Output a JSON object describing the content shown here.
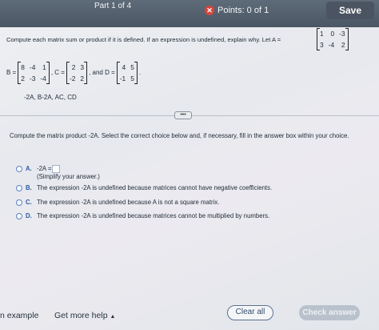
{
  "header": {
    "part_label": "Part 1 of 4",
    "points_label": "Points: 0 of 1",
    "save_label": "Save"
  },
  "problem": {
    "prompt": "Compute each matrix sum or product if it is defined. If an expression is undefined, explain why. Let A =",
    "matrix_A": [
      [
        "1",
        "0",
        "-3"
      ],
      [
        "3",
        "-4",
        "2"
      ]
    ],
    "b_label": "B =",
    "matrix_B": [
      [
        "8",
        "-4",
        "1"
      ],
      [
        "2",
        "-3",
        "-4"
      ]
    ],
    "c_label": ", C =",
    "matrix_C": [
      [
        "2",
        "3"
      ],
      [
        "-2",
        "2"
      ]
    ],
    "d_label": ", and D =",
    "matrix_D": [
      [
        "4",
        "5"
      ],
      [
        "-1",
        "5"
      ]
    ],
    "d_end": ".",
    "tasks": "-2A, B-2A, AC, CD"
  },
  "more_label": "•••",
  "question": {
    "text": "Compute the matrix product -2A. Select the correct choice below and, if necessary, fill in the answer box within your choice.",
    "options": [
      {
        "letter": "A.",
        "line1": "-2A =",
        "line2": "(Simplify your answer.)"
      },
      {
        "letter": "B.",
        "line1": "The expression -2A is undefined because matrices cannot have negative coefficients."
      },
      {
        "letter": "C.",
        "line1": "The expression -2A is undefined because A is not a square matrix."
      },
      {
        "letter": "D.",
        "line1": "The expression -2A is undefined because matrices cannot be multiplied by numbers."
      }
    ]
  },
  "footer": {
    "example_label": "n example",
    "more_help_label": "Get more help",
    "more_help_caret": "▲",
    "clear_label": "Clear all",
    "check_label": "Check answer"
  }
}
